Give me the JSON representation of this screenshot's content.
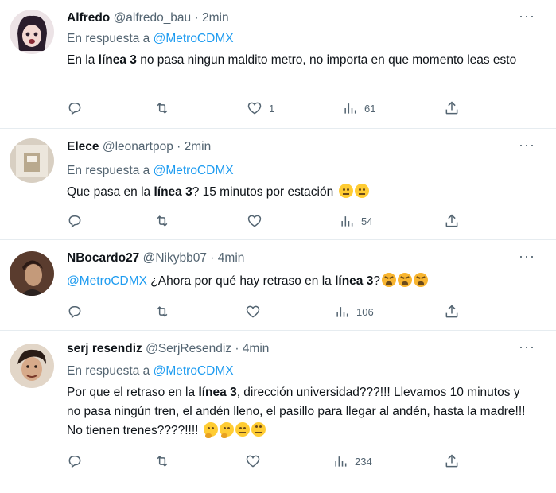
{
  "tweets": [
    {
      "name": "Alfredo",
      "handle": "@alfredo_bau",
      "sep": "·",
      "time": "2min",
      "reply_prefix": "En respuesta a",
      "reply_to": "@MetroCDMX",
      "text_parts": [
        "En la ",
        "línea 3",
        " no pasa ningun maldito metro, no importa en que momento leas esto"
      ],
      "counts": {
        "reply": "",
        "retweet": "",
        "like": "1",
        "views": "61"
      },
      "avatar_colors": [
        "#e8d9dd",
        "#3b2a3a"
      ]
    },
    {
      "name": "Elece",
      "handle": "@leonartpop",
      "sep": "·",
      "time": "2min",
      "reply_prefix": "En respuesta a",
      "reply_to": "@MetroCDMX",
      "text_parts": [
        "Que pasa en la ",
        "línea 3",
        "? 15 minutos por estación "
      ],
      "counts": {
        "reply": "",
        "retweet": "",
        "like": "",
        "views": "54"
      },
      "avatar_colors": [
        "#cfc6b9",
        "#8a7d6a"
      ]
    },
    {
      "name": "NBocardo27",
      "handle": "@Nikybb07",
      "sep": "·",
      "time": "4min",
      "reply_prefix": "",
      "reply_to": "",
      "mention": "@MetroCDMX",
      "text_parts": [
        " ¿Ahora por qué hay retraso en la ",
        "línea 3",
        "?"
      ],
      "counts": {
        "reply": "",
        "retweet": "",
        "like": "",
        "views": "106"
      },
      "avatar_colors": [
        "#6b4a3a",
        "#c9a98a"
      ]
    },
    {
      "name": "serj resendiz",
      "handle": "@SerjResendiz",
      "sep": "·",
      "time": "4min",
      "reply_prefix": "En respuesta a",
      "reply_to": "@MetroCDMX",
      "text_parts": [
        "Por que el retraso en la ",
        "línea 3",
        ", dirección universidad???!!! Llevamos 10 minutos y no pasa ningún tren, el andén lleno, el pasillo para llegar al andén, hasta la madre!!! No tienen trenes????!!!! "
      ],
      "counts": {
        "reply": "",
        "retweet": "",
        "like": "",
        "views": "234"
      },
      "avatar_colors": [
        "#d9c8b8",
        "#3a2a22"
      ]
    }
  ],
  "icons": {
    "more": "more-dots-icon",
    "reply": "reply-icon",
    "retweet": "retweet-icon",
    "like": "heart-icon",
    "views": "views-chart-icon",
    "share": "share-icon"
  },
  "colors": {
    "link": "#1d9bf0",
    "muted": "#536471",
    "text": "#0f1419"
  }
}
